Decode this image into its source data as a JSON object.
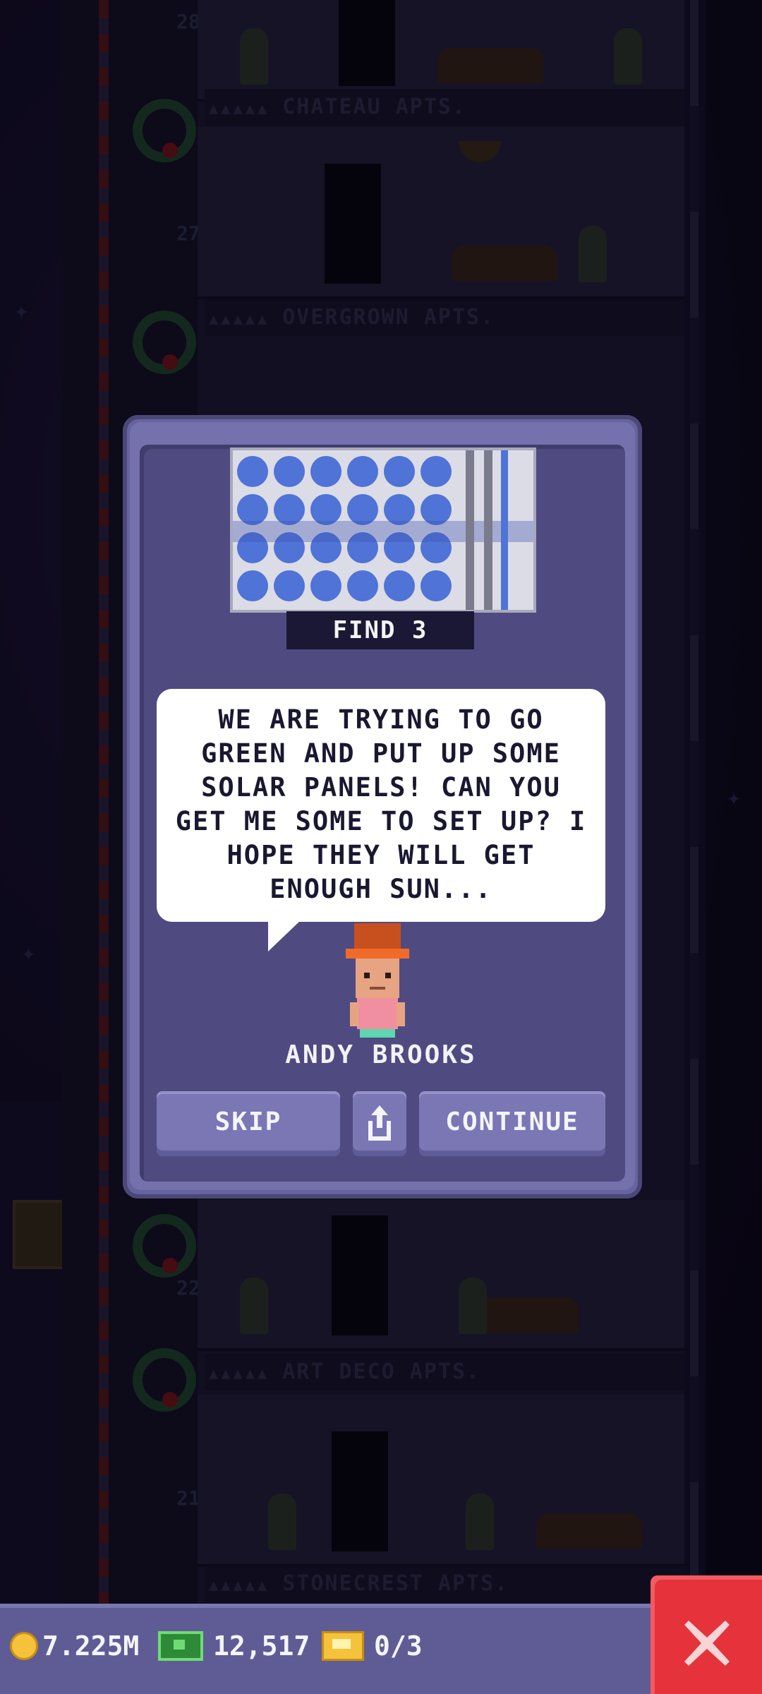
{
  "background": {
    "floor_numbers": [
      "28",
      "27",
      "22",
      "21"
    ],
    "floor_signs": [
      "CHATEAU APTS.",
      "OVERGROWN APTS.",
      "ART DECO APTS.",
      "STONECREST APTS."
    ],
    "sign_stars": "▲▲▲▲▲"
  },
  "mission": {
    "item_icon": "solar-panel-icon",
    "find_label": "FIND 3",
    "speech": "WE ARE TRYING TO GO GREEN AND PUT UP SOME SOLAR PANELS! CAN YOU GET ME SOME TO SET UP? I HOPE THEY WILL GET ENOUGH SUN...",
    "npc_name": "ANDY BROOKS"
  },
  "buttons": {
    "skip": "SKIP",
    "share_icon": "share-icon",
    "continue": "CONTINUE"
  },
  "hud": {
    "coins": "7.225M",
    "bux": "12,517",
    "tickets": "0/3",
    "close_icon": "close-icon"
  },
  "colors": {
    "dialog": "#6663a0",
    "dialog_inner": "#4f4b81",
    "close_button": "#e5323b",
    "coin": "#f5c23b",
    "bux": "#2e8a36"
  }
}
